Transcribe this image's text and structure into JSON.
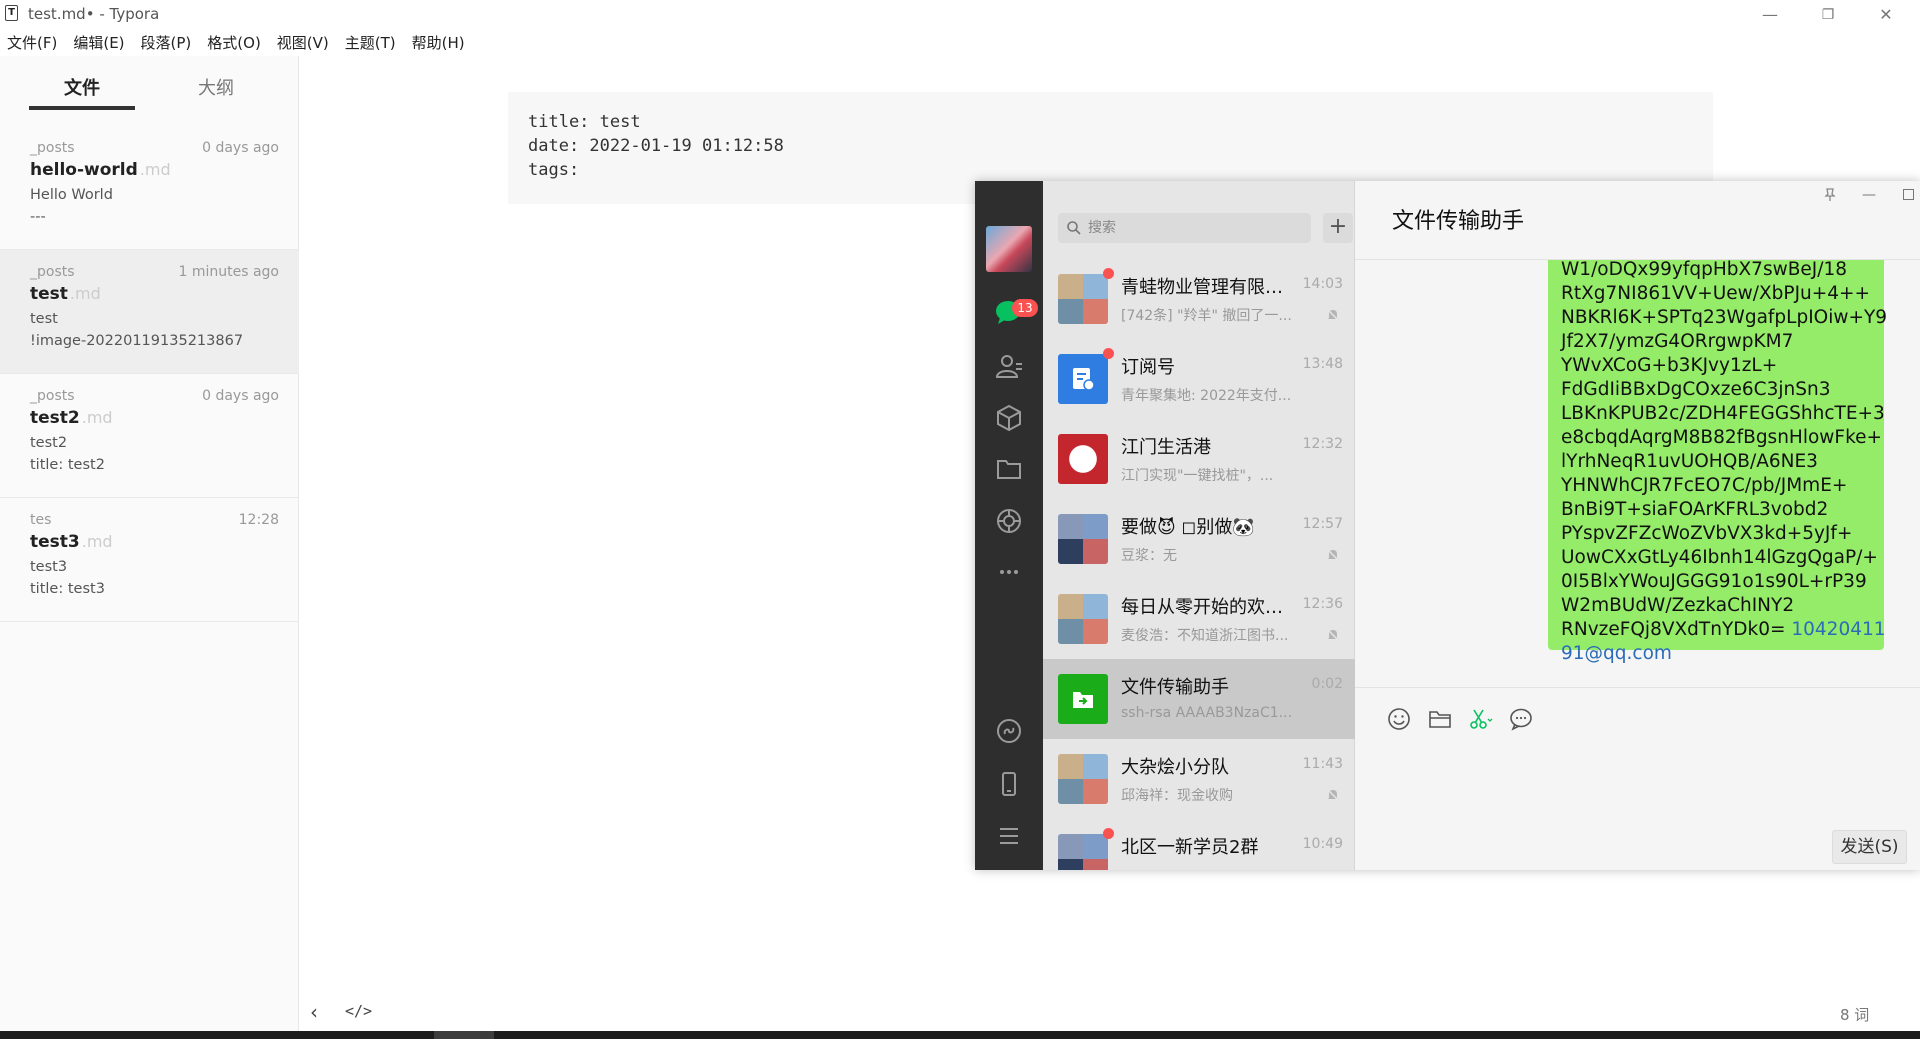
{
  "typora": {
    "window_title": "test.md• - Typora",
    "app_icon_letter": "T",
    "window_controls": {
      "minimize": "—",
      "restore": "❐",
      "close": "✕"
    },
    "menu": [
      "文件(F)",
      "编辑(E)",
      "段落(P)",
      "格式(O)",
      "视图(V)",
      "主题(T)",
      "帮助(H)"
    ],
    "sidebar": {
      "tabs": {
        "files": "文件",
        "outline": "大纲"
      },
      "files": [
        {
          "folder": "_posts",
          "time": "0 days ago",
          "name": "hello-world",
          "ext": ".md",
          "line1": "Hello World",
          "line2": "---"
        },
        {
          "folder": "_posts",
          "time": "1 minutes ago",
          "name": "test",
          "ext": ".md",
          "line1": "test",
          "line2": "!image-20220119135213867",
          "active": true
        },
        {
          "folder": "_posts",
          "time": "0 days ago",
          "name": "test2",
          "ext": ".md",
          "line1": "test2",
          "line2": "title: test2"
        },
        {
          "folder": "tes",
          "time": "12:28",
          "name": "test3",
          "ext": ".md",
          "line1": "test3",
          "line2": "title: test3"
        }
      ]
    },
    "editor": {
      "front_matter": [
        "title: test",
        "date: 2022-01-19 01:12:58",
        "tags:"
      ]
    },
    "footer": {
      "back": "‹",
      "source_toggle": "</>",
      "word_count": "8 词"
    }
  },
  "wechat": {
    "badge_count": "13",
    "search_placeholder": "搜索",
    "add_label": "+",
    "conversations": [
      {
        "name": "青蛙物业管理有限公...",
        "time": "14:03",
        "preview": "[742条] \"羚羊\" 撤回了一...",
        "unread_dot": true,
        "muted": true,
        "avatar": "group"
      },
      {
        "name": "订阅号",
        "time": "13:48",
        "preview": "青年聚集地: 2022年支付...",
        "unread_dot": true,
        "muted": false,
        "avatar": "subscription"
      },
      {
        "name": "江门生活港",
        "time": "12:32",
        "preview": "江门实现\"一键找桩\"，...",
        "unread_dot": false,
        "muted": false,
        "avatar": "jiangmen"
      },
      {
        "name": "要做😈 ◻别做🐼",
        "time": "12:57",
        "preview": "豆浆：无",
        "unread_dot": false,
        "muted": true,
        "avatar": "group"
      },
      {
        "name": "每日从零开始的欢乐...",
        "time": "12:36",
        "preview": "麦俊浩：不知道浙江图书...",
        "unread_dot": false,
        "muted": true,
        "avatar": "group"
      },
      {
        "name": "文件传输助手",
        "time": "0:02",
        "preview": "ssh-rsa AAAAB3NzaC1...",
        "unread_dot": false,
        "muted": false,
        "avatar": "filehelper",
        "active": true
      },
      {
        "name": "大杂烩小分队",
        "time": "11:43",
        "preview": "邱海祥：现金收购",
        "unread_dot": false,
        "muted": true,
        "avatar": "group"
      },
      {
        "name": "北区一新学员2群",
        "time": "10:49",
        "preview": "",
        "unread_dot": true,
        "muted": false,
        "avatar": "group"
      }
    ],
    "chat": {
      "title": "文件传输助手",
      "message_lines": [
        "W1/oDQx99yfqpHbX7swBeJ/18",
        "RtXg7NI861VV+Uew/XbPJu+4++",
        "NBKRl6K+SPTq23WgafpLpIOiw+Y9",
        "Jf2X7/ymzG4ORrgwpKM7",
        "YWvXCoG+b3KJvy1zL+",
        "FdGdIiBBxDgCOxze6C3jnSn3",
        "LBKnKPUB2c/ZDH4FEGGShhcTE+3",
        "e8cbqdAqrgM8B82fBgsnHlowFke+",
        "lYrhNeqR1uvUOHQB/A6NE3",
        "YHNWhCJR7FcEO7C/pb/JMmE+",
        "BnBi9T+siaFOArKFRL3vobd2",
        "PYspvZFZcWoZVbVX3kd+5yJf+",
        "UowCXxGtLy46Ibnh14lGzgQgaP/+",
        "0I5BlxYWouJGGG91o1s90L+rP39",
        "W2mBUdW/ZezkaChINY2",
        "RNvzeFQj8VXdTnYDk0= "
      ],
      "email_part1": "10420411",
      "email_part2": "91@qq.com",
      "send_label": "发送(S)"
    }
  }
}
